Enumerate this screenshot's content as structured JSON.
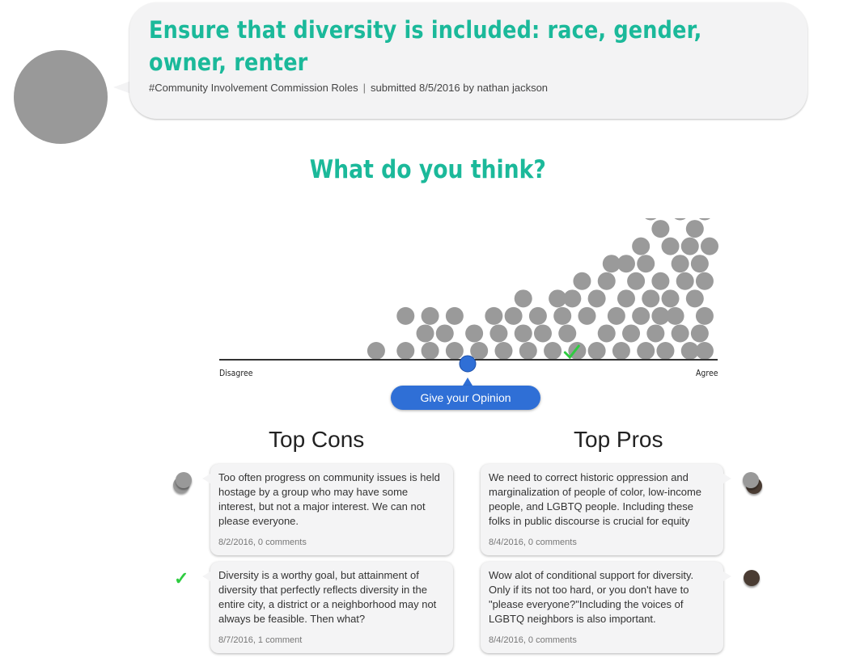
{
  "header": {
    "title": "Ensure that diversity is included: race, gender, owner, renter",
    "tag": "#Community Involvement Commission Roles",
    "separator": "|",
    "submitted": "submitted 8/5/2016 by nathan jackson"
  },
  "question": "What do you think?",
  "scale": {
    "left_label": "Disagree",
    "right_label": "Agree",
    "user_position": 0.5
  },
  "opinion_button": "Give your Opinion",
  "cons": {
    "title": "Top Cons",
    "items": [
      {
        "text": "Too often progress on community issues is held hostage by a group who may have some interest, but not a major interest. We can not please everyone.",
        "date": "8/2/2016, 0 comments"
      },
      {
        "text": "Diversity is a worthy goal, but attainment of diversity that perfectly reflects diversity in the entire city, a district or a neighborhood may not always be feasible. Then what?",
        "date": "8/7/2016, 1 comment"
      }
    ]
  },
  "pros": {
    "title": "Top Pros",
    "items": [
      {
        "text": "We need to correct historic oppression and marginalization of people of color, low-income people, and LGBTQ people. Including these folks in public discourse is crucial for equity",
        "date": "8/4/2016, 0 comments"
      },
      {
        "text": "Wow alot of conditional support for diversity. Only if its not too hard, or you don't have to \"please everyone?\"Including the voices of LGBTQ neighbors is also important.",
        "date": "8/4/2016, 0 comments"
      }
    ]
  },
  "colors": {
    "accent": "#1bb99a",
    "button": "#2f6fd6",
    "dot": "#9a9a9a",
    "check": "#2ecc40"
  },
  "chart_data": {
    "type": "scatter",
    "description_scale": "opinions on a disagree (0) to agree (1) scale",
    "points": [
      {
        "x": 0.32,
        "level": 0
      },
      {
        "x": 0.38,
        "level": 0
      },
      {
        "x": 0.42,
        "level": 1
      },
      {
        "x": 0.38,
        "level": 2
      },
      {
        "x": 0.43,
        "level": 0
      },
      {
        "x": 0.46,
        "level": 1
      },
      {
        "x": 0.43,
        "level": 2
      },
      {
        "x": 0.48,
        "level": 0
      },
      {
        "x": 0.48,
        "level": 2
      },
      {
        "x": 0.52,
        "level": 1
      },
      {
        "x": 0.53,
        "level": 0
      },
      {
        "x": 0.56,
        "level": 2
      },
      {
        "x": 0.57,
        "level": 1
      },
      {
        "x": 0.58,
        "level": 0
      },
      {
        "x": 0.6,
        "level": 2
      },
      {
        "x": 0.62,
        "level": 1
      },
      {
        "x": 0.63,
        "level": 0
      },
      {
        "x": 0.62,
        "level": 3
      },
      {
        "x": 0.65,
        "level": 2
      },
      {
        "x": 0.66,
        "level": 1
      },
      {
        "x": 0.68,
        "level": 0
      },
      {
        "x": 0.7,
        "level": 2
      },
      {
        "x": 0.71,
        "level": 1
      },
      {
        "x": 0.73,
        "level": 0
      },
      {
        "x": 0.72,
        "level": 3
      },
      {
        "x": 0.75,
        "level": 2
      },
      {
        "x": 0.77,
        "level": 0
      },
      {
        "x": 0.79,
        "level": 1
      },
      {
        "x": 0.82,
        "level": 0
      },
      {
        "x": 0.81,
        "level": 2
      },
      {
        "x": 0.77,
        "level": 3
      },
      {
        "x": 0.84,
        "level": 1
      },
      {
        "x": 0.87,
        "level": 0
      },
      {
        "x": 0.86,
        "level": 2
      },
      {
        "x": 0.83,
        "level": 3
      },
      {
        "x": 0.85,
        "level": 4
      },
      {
        "x": 0.8,
        "level": 5
      },
      {
        "x": 0.89,
        "level": 1
      },
      {
        "x": 0.91,
        "level": 0
      },
      {
        "x": 0.9,
        "level": 2
      },
      {
        "x": 0.88,
        "level": 3
      },
      {
        "x": 0.87,
        "level": 5
      },
      {
        "x": 0.9,
        "level": 4
      },
      {
        "x": 0.94,
        "level": 1
      },
      {
        "x": 0.96,
        "level": 0
      },
      {
        "x": 0.93,
        "level": 2
      },
      {
        "x": 0.92,
        "level": 3
      },
      {
        "x": 0.95,
        "level": 4
      },
      {
        "x": 0.94,
        "level": 5
      },
      {
        "x": 0.92,
        "level": 6
      },
      {
        "x": 0.9,
        "level": 7
      },
      {
        "x": 0.96,
        "level": 6
      },
      {
        "x": 0.94,
        "level": 8
      },
      {
        "x": 0.97,
        "level": 3
      },
      {
        "x": 0.99,
        "level": 0
      },
      {
        "x": 0.99,
        "level": 2
      },
      {
        "x": 0.98,
        "level": 5
      },
      {
        "x": 0.97,
        "level": 7
      },
      {
        "x": 0.99,
        "level": 4
      },
      {
        "x": 1.0,
        "level": 6
      },
      {
        "x": 0.98,
        "level": 1
      },
      {
        "x": 0.86,
        "level": 6
      },
      {
        "x": 0.88,
        "level": 8
      },
      {
        "x": 0.83,
        "level": 5
      },
      {
        "x": 0.79,
        "level": 4
      },
      {
        "x": 0.74,
        "level": 4
      },
      {
        "x": 0.69,
        "level": 3
      },
      {
        "x": 0.99,
        "level": 8
      },
      {
        "x": 0.97,
        "level": 9
      },
      {
        "x": 0.93,
        "level": 9
      },
      {
        "x": 0.91,
        "level": 10
      },
      {
        "x": 0.95,
        "level": 10
      },
      {
        "x": 0.99,
        "level": 10
      }
    ],
    "marked_x": 0.72
  }
}
